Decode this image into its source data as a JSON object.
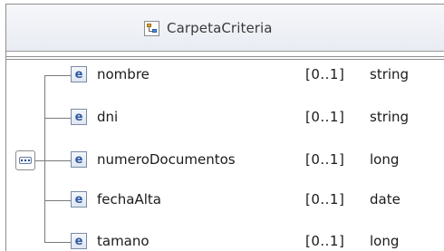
{
  "complex_type": {
    "title": "CarpetaCriteria",
    "icon": "complex-type-icon"
  },
  "sequence": {
    "icon": "sequence-compositor-icon"
  },
  "elements": [
    {
      "icon_letter": "e",
      "name": "nombre",
      "occurs": "[0..1]",
      "type": "string"
    },
    {
      "icon_letter": "e",
      "name": "dni",
      "occurs": "[0..1]",
      "type": "string"
    },
    {
      "icon_letter": "e",
      "name": "numeroDocumentos",
      "occurs": "[0..1]",
      "type": "long"
    },
    {
      "icon_letter": "e",
      "name": "fechaAlta",
      "occurs": "[0..1]",
      "type": "date"
    },
    {
      "icon_letter": "e",
      "name": "tamano",
      "occurs": "[0..1]",
      "type": "long"
    }
  ]
}
